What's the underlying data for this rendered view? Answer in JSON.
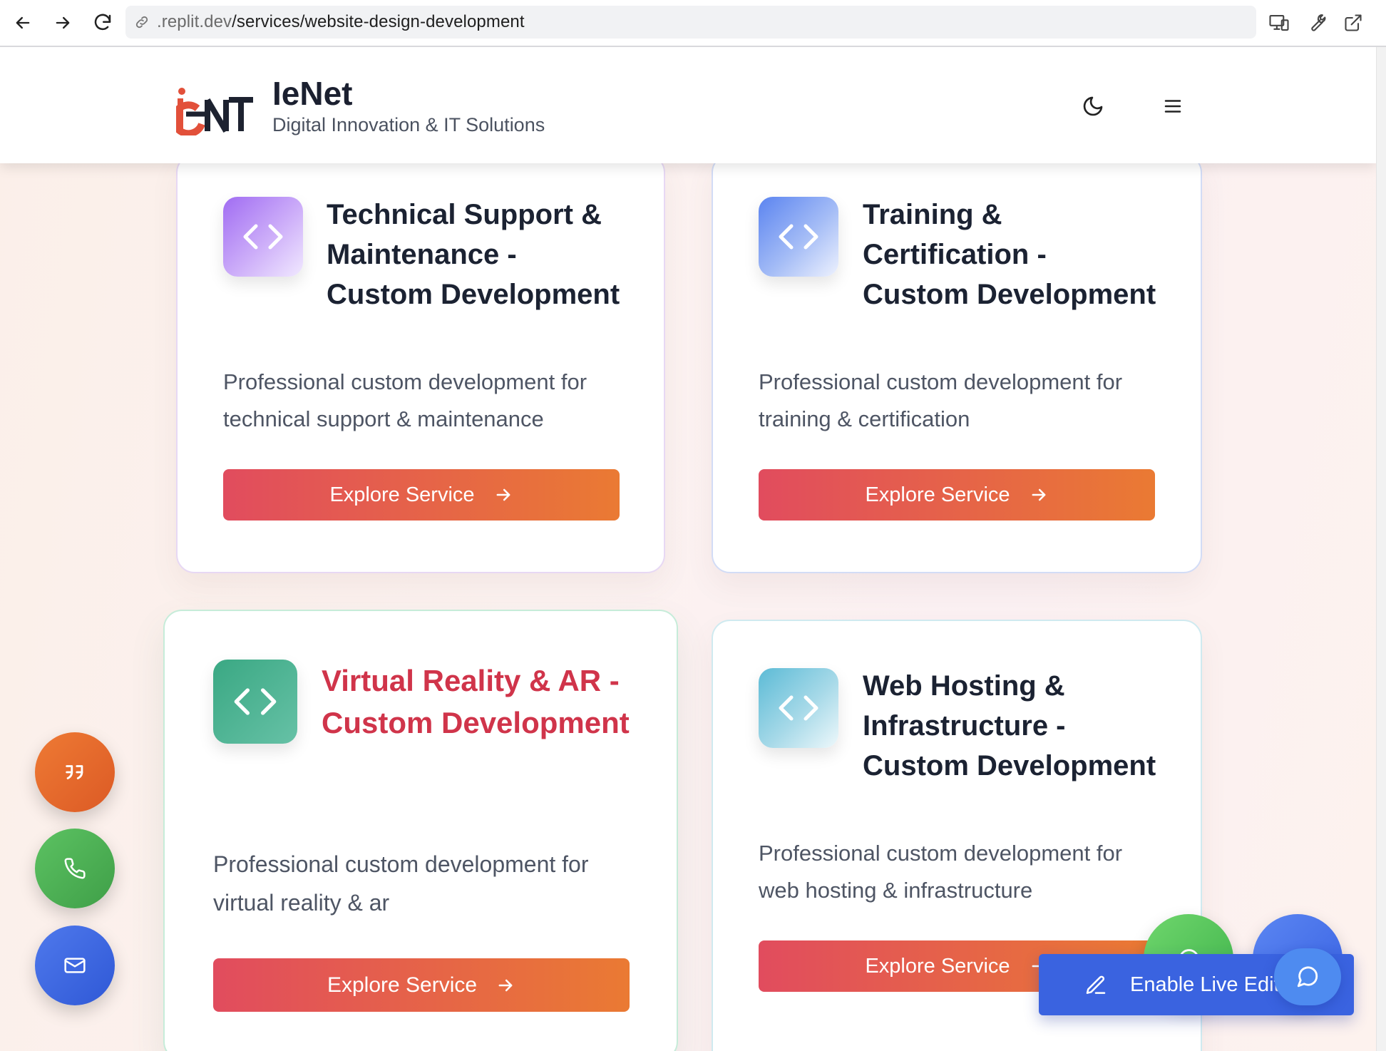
{
  "browser": {
    "url_prefix": ".replit.dev",
    "url_path": "/services/website-design-development"
  },
  "header": {
    "brand_name": "IeNet",
    "tagline": "Digital Innovation & IT Solutions",
    "logo_text": "IeNT",
    "logo_colors": {
      "accent": "#e2503a",
      "dark": "#1d2230"
    }
  },
  "cards": [
    {
      "title_lines": [
        "Technical Support &",
        "Maintenance -",
        "Custom Development"
      ],
      "desc_lines": [
        "Professional custom development for",
        "technical support & maintenance"
      ],
      "button": "Explore Service",
      "icon": "code-icon",
      "icon_gradient": [
        "#a06cf2",
        "#efe6ff"
      ]
    },
    {
      "title_lines": [
        "Training &",
        "Certification -",
        "Custom Development"
      ],
      "desc_lines": [
        "Professional custom development for",
        "training & certification"
      ],
      "button": "Explore Service",
      "icon": "code-icon",
      "icon_gradient": [
        "#5b84f0",
        "#e8eefe"
      ]
    },
    {
      "title_lines": [
        "Virtual Reality & AR -",
        "Custom Development"
      ],
      "desc_lines": [
        "Professional custom development for",
        "virtual reality & ar"
      ],
      "button": "Explore Service",
      "icon": "code-icon",
      "icon_gradient": [
        "#3fab86",
        "#62bfa4"
      ],
      "title_color": "#d0344a",
      "hovered": true
    },
    {
      "title_lines": [
        "Web Hosting &",
        "Infrastructure -",
        "Custom Development"
      ],
      "desc_lines": [
        "Professional custom development for",
        "web hosting & infrastructure"
      ],
      "button": "Explore Service",
      "icon": "code-icon",
      "icon_gradient": [
        "#5cbbd6",
        "#eaf7fb"
      ]
    }
  ],
  "floating_actions": [
    {
      "name": "quote-icon",
      "color": "#e56a2c"
    },
    {
      "name": "phone-icon",
      "color": "#4caf50"
    },
    {
      "name": "mail-icon",
      "color": "#3b63e0"
    }
  ],
  "live_edit": {
    "label": "Enable Live Editing"
  }
}
